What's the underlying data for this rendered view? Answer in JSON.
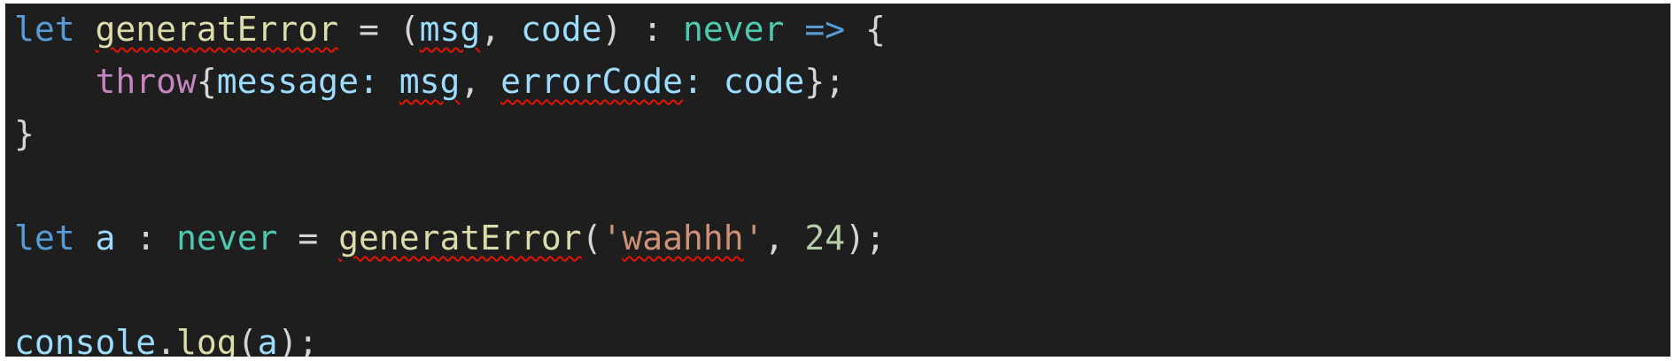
{
  "editor": {
    "lines": [
      {
        "tokens": [
          {
            "text": "let",
            "kind": "keyword",
            "squiggle": false
          },
          {
            "text": " ",
            "kind": "punct",
            "squiggle": false
          },
          {
            "text": "generatError",
            "kind": "function",
            "squiggle": true
          },
          {
            "text": " = (",
            "kind": "punct",
            "squiggle": false
          },
          {
            "text": "msg",
            "kind": "variable",
            "squiggle": true
          },
          {
            "text": ", ",
            "kind": "punct",
            "squiggle": false
          },
          {
            "text": "code",
            "kind": "variable",
            "squiggle": false
          },
          {
            "text": ") : ",
            "kind": "punct",
            "squiggle": false
          },
          {
            "text": "never",
            "kind": "type",
            "squiggle": false
          },
          {
            "text": " ",
            "kind": "punct",
            "squiggle": false
          },
          {
            "text": "=>",
            "kind": "keyword",
            "squiggle": false
          },
          {
            "text": " {",
            "kind": "punct",
            "squiggle": false
          }
        ]
      },
      {
        "tokens": [
          {
            "text": "    ",
            "kind": "punct",
            "squiggle": false
          },
          {
            "text": "throw",
            "kind": "control",
            "squiggle": false
          },
          {
            "text": "{",
            "kind": "punct",
            "squiggle": false
          },
          {
            "text": "message",
            "kind": "variable",
            "squiggle": false
          },
          {
            "text": ": ",
            "kind": "variable",
            "squiggle": false
          },
          {
            "text": "msg",
            "kind": "variable",
            "squiggle": true
          },
          {
            "text": ", ",
            "kind": "punct",
            "squiggle": false
          },
          {
            "text": "errorCode",
            "kind": "variable",
            "squiggle": true
          },
          {
            "text": ": ",
            "kind": "variable",
            "squiggle": false
          },
          {
            "text": "code",
            "kind": "variable",
            "squiggle": false
          },
          {
            "text": "};",
            "kind": "punct",
            "squiggle": false
          }
        ]
      },
      {
        "tokens": [
          {
            "text": "}",
            "kind": "punct",
            "squiggle": false
          }
        ]
      },
      {
        "tokens": []
      },
      {
        "tokens": [
          {
            "text": "let",
            "kind": "keyword",
            "squiggle": false
          },
          {
            "text": " ",
            "kind": "punct",
            "squiggle": false
          },
          {
            "text": "a",
            "kind": "variable",
            "squiggle": false
          },
          {
            "text": " : ",
            "kind": "punct",
            "squiggle": false
          },
          {
            "text": "never",
            "kind": "type",
            "squiggle": false
          },
          {
            "text": " = ",
            "kind": "punct",
            "squiggle": false
          },
          {
            "text": "generatError",
            "kind": "function",
            "squiggle": true
          },
          {
            "text": "(",
            "kind": "punct",
            "squiggle": false
          },
          {
            "text": "'",
            "kind": "string",
            "squiggle": false
          },
          {
            "text": "waahhh",
            "kind": "string",
            "squiggle": true
          },
          {
            "text": "'",
            "kind": "string",
            "squiggle": false
          },
          {
            "text": ", ",
            "kind": "punct",
            "squiggle": false
          },
          {
            "text": "24",
            "kind": "number",
            "squiggle": false
          },
          {
            "text": ");",
            "kind": "punct",
            "squiggle": false
          }
        ]
      },
      {
        "tokens": []
      },
      {
        "tokens": [
          {
            "text": "console",
            "kind": "variable",
            "squiggle": false
          },
          {
            "text": ".",
            "kind": "punct",
            "squiggle": false
          },
          {
            "text": "log",
            "kind": "function",
            "squiggle": false
          },
          {
            "text": "(",
            "kind": "punct",
            "squiggle": false
          },
          {
            "text": "a",
            "kind": "variable",
            "squiggle": false
          },
          {
            "text": ");",
            "kind": "punct",
            "squiggle": false
          }
        ]
      }
    ]
  },
  "colors": {
    "background": "#1e1e1e",
    "keyword": "#569cd6",
    "function": "#dcdcaa",
    "variable": "#9cdcfe",
    "type": "#4ec9b0",
    "control": "#c586c0",
    "string": "#ce9178",
    "number": "#b5cea8",
    "punct": "#d4d4d4",
    "squiggle": "#e51400"
  }
}
